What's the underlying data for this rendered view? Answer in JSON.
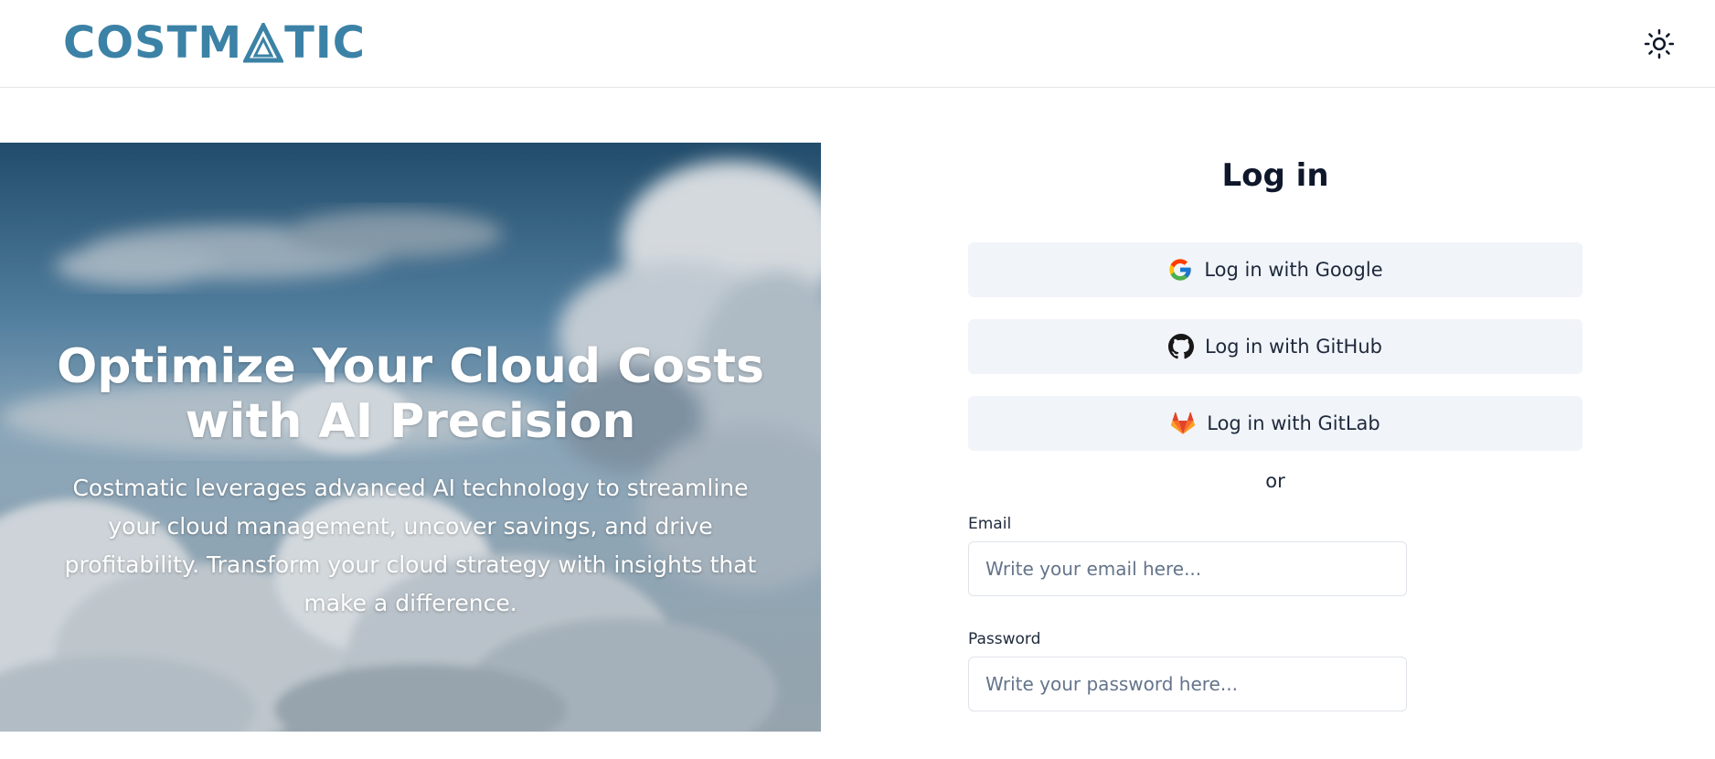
{
  "header": {
    "logo_text_start": "COSTM",
    "logo_text_end": "TIC",
    "brand_color": "#3b82a6",
    "theme_toggle_icon": "sun-icon"
  },
  "hero": {
    "title": "Optimize Your Cloud Costs with AI Precision",
    "description": "Costmatic leverages advanced AI technology to streamline your cloud management, uncover savings, and drive profitability. Transform your cloud strategy with insights that make a difference."
  },
  "login": {
    "title": "Log in",
    "google_label": "Log in with Google",
    "github_label": "Log in with GitHub",
    "gitlab_label": "Log in with GitLab",
    "or_text": "or",
    "email_label": "Email",
    "email_placeholder": "Write your email here...",
    "password_label": "Password",
    "password_placeholder": "Write your password here..."
  }
}
